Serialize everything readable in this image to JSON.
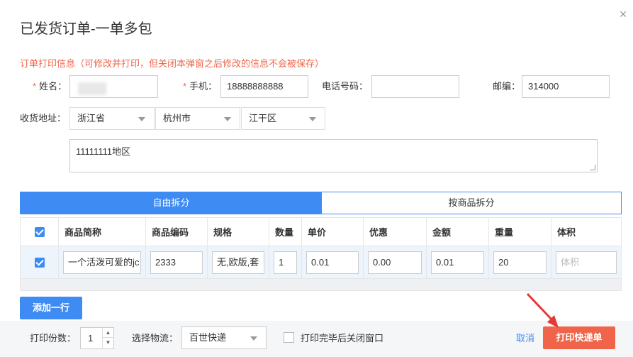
{
  "dialog": {
    "title": "已发货订单-一单多包",
    "close_glyph": "×"
  },
  "notice": "订单打印信息（可修改并打印，但关闭本弹窗之后修改的信息不会被保存）",
  "form": {
    "name_label": "姓名：",
    "name_value": "",
    "phone_label": "手机：",
    "phone_value": "18888888888",
    "tel_label": "电话号码：",
    "tel_value": "",
    "zip_label": "邮编：",
    "zip_value": "314000",
    "address_label": "收货地址：",
    "province": "浙江省",
    "city": "杭州市",
    "district": "江干区",
    "address_detail": "11111111地区",
    "required_mark": "*"
  },
  "tabs": {
    "free_split": "自由拆分",
    "by_product": "按商品拆分"
  },
  "table": {
    "headers": [
      "商品简称",
      "商品编码",
      "规格",
      "数量",
      "单价",
      "优惠",
      "金额",
      "重量",
      "体积"
    ],
    "rows": [
      {
        "name": "一个活泼可爱的jc",
        "code": "2333",
        "spec": "无,欧版,套",
        "qty": "1",
        "price": "0.01",
        "discount": "0.00",
        "amount": "0.01",
        "weight": "20",
        "volume_placeholder": "体积"
      }
    ]
  },
  "add_row_label": "添加一行",
  "footer": {
    "copies_label": "打印份数：",
    "copies_value": "1",
    "logistics_label": "选择物流：",
    "logistics_value": "百世快递",
    "close_after_print": "打印完毕后关闭窗口",
    "cancel_label": "取消",
    "print_label": "打印快递单"
  },
  "colors": {
    "primary": "#3d8bf3",
    "danger": "#f0654a",
    "annotation_arrow": "#e53935"
  }
}
